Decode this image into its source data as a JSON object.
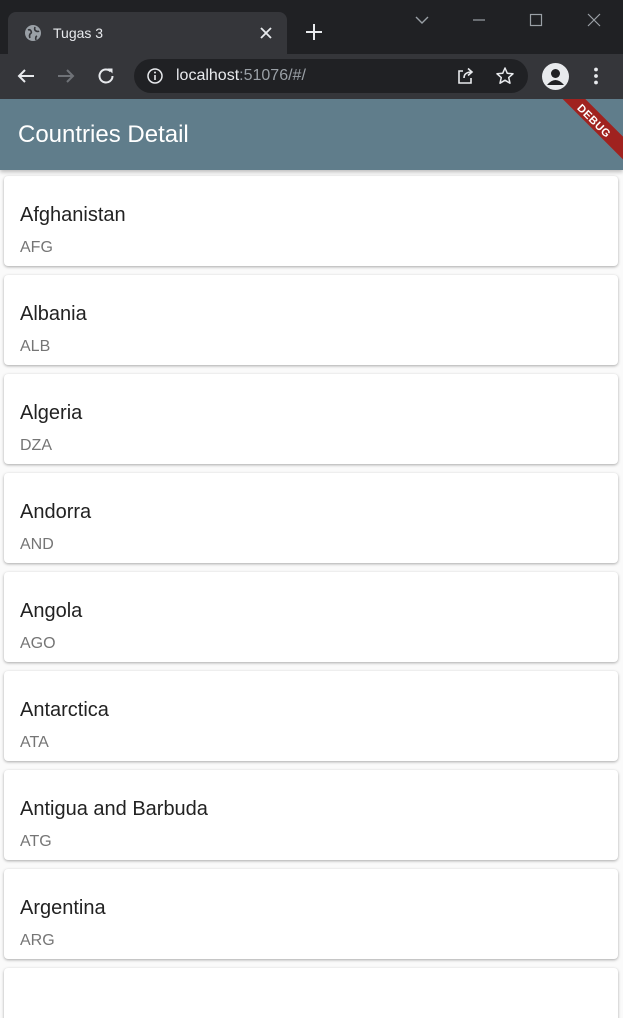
{
  "browser": {
    "tab_title": "Tugas 3",
    "url_host": "localhost",
    "url_rest": ":51076/#/"
  },
  "app": {
    "title": "Countries Detail",
    "debug_label": "DEBUG",
    "colors": {
      "appbar": "#607d8b",
      "debug_banner": "#a0221f"
    }
  },
  "countries": [
    {
      "name": "Afghanistan",
      "code": "AFG"
    },
    {
      "name": "Albania",
      "code": "ALB"
    },
    {
      "name": "Algeria",
      "code": "DZA"
    },
    {
      "name": "Andorra",
      "code": "AND"
    },
    {
      "name": "Angola",
      "code": "AGO"
    },
    {
      "name": "Antarctica",
      "code": "ATA"
    },
    {
      "name": "Antigua and Barbuda",
      "code": "ATG"
    },
    {
      "name": "Argentina",
      "code": "ARG"
    }
  ]
}
